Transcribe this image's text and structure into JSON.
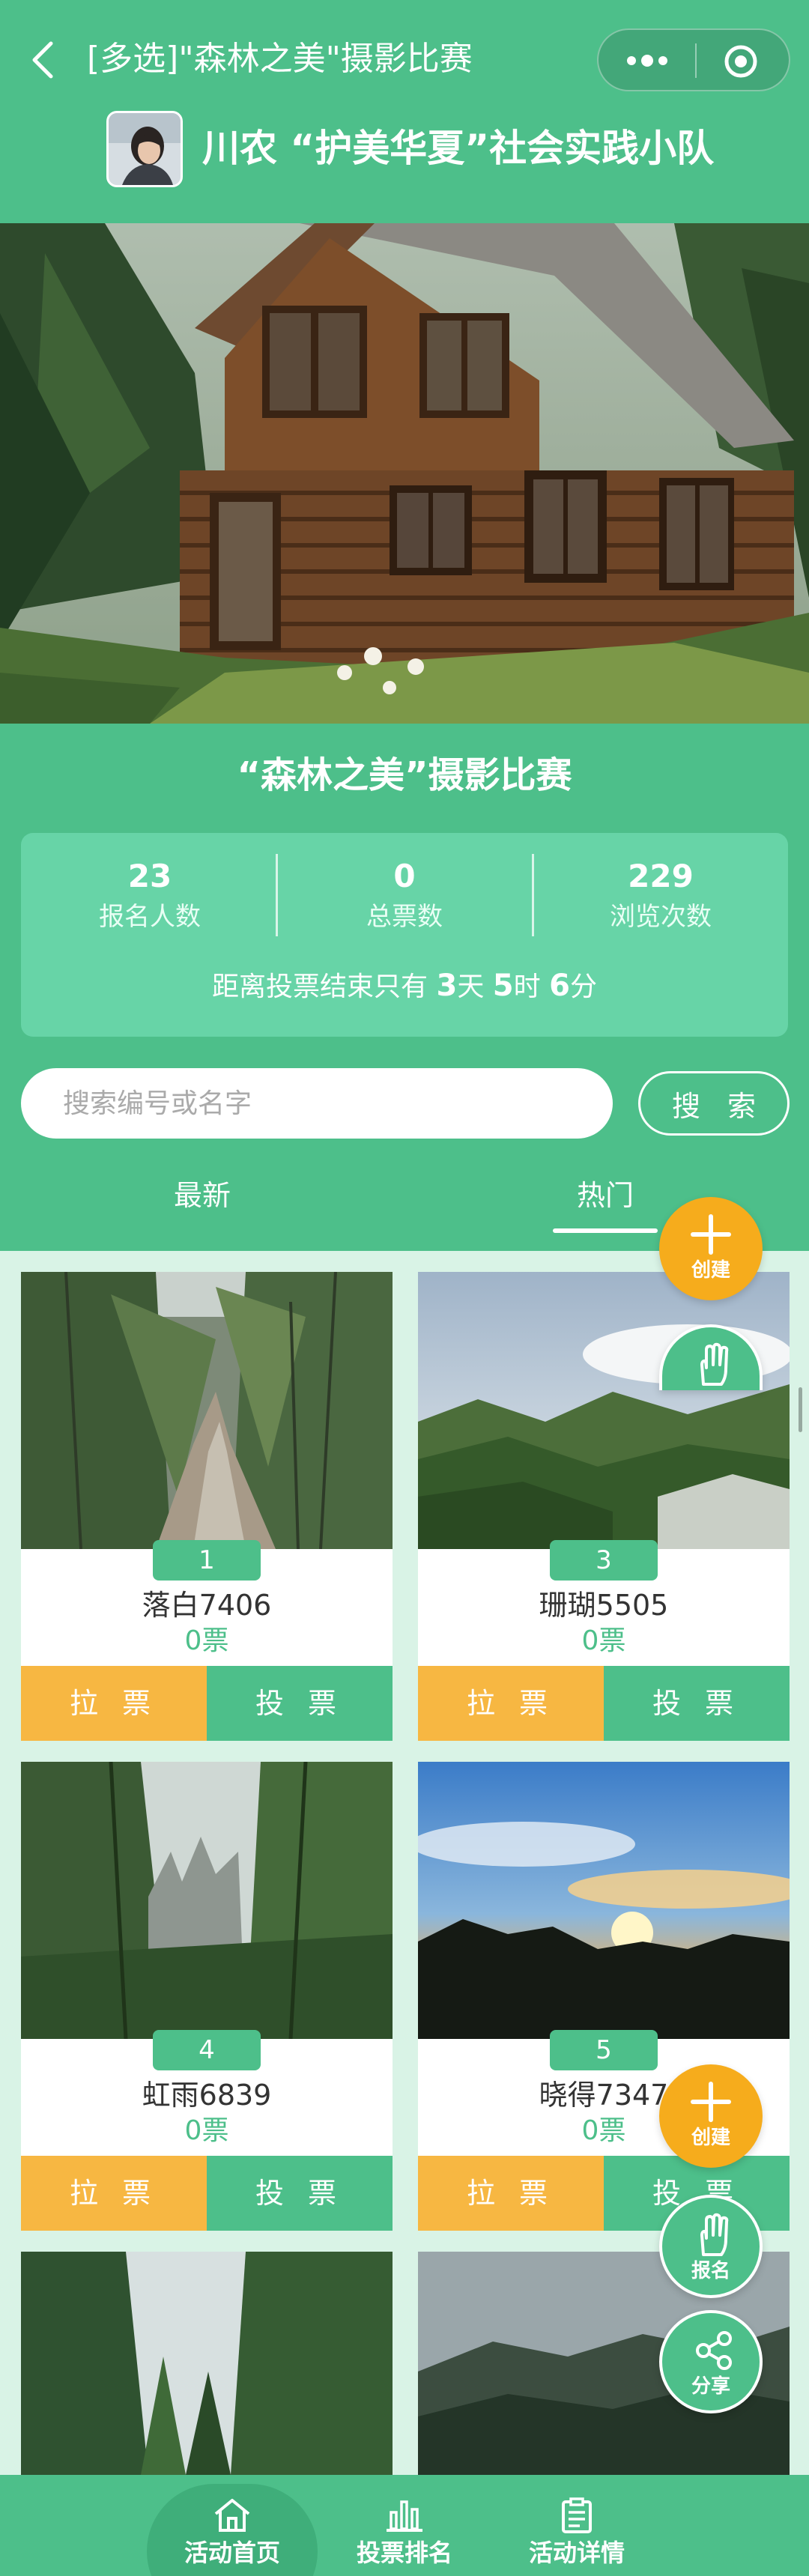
{
  "nav_bar": {
    "title": "[多选]\"森林之美\"摄影比赛"
  },
  "organizer": {
    "name": "川农 “护美华夏”社会实践小队"
  },
  "event": {
    "title": "“森林之美”摄影比赛",
    "stats": [
      {
        "value": "23",
        "label": "报名人数"
      },
      {
        "value": "0",
        "label": "总票数"
      },
      {
        "value": "229",
        "label": "浏览次数"
      }
    ],
    "countdown": {
      "prefix": "距离投票结束只有",
      "days": "3",
      "day_unit": "天",
      "hours": "5",
      "hour_unit": "时",
      "minutes": "6",
      "minute_unit": "分"
    }
  },
  "search": {
    "placeholder": "搜索编号或名字",
    "value": "",
    "button_label": "搜 索"
  },
  "tabs": [
    {
      "label": "最新",
      "active": false
    },
    {
      "label": "热门",
      "active": true
    }
  ],
  "entries": [
    {
      "number": "1",
      "name": "落白7406",
      "votes": "0票",
      "canvass_label": "拉 票",
      "vote_label": "投 票"
    },
    {
      "number": "3",
      "name": "珊瑚5505",
      "votes": "0票",
      "canvass_label": "拉 票",
      "vote_label": "投 票"
    },
    {
      "number": "4",
      "name": "虹雨6839",
      "votes": "0票",
      "canvass_label": "拉 票",
      "vote_label": "投 票"
    },
    {
      "number": "5",
      "name": "晓得7347",
      "votes": "0票",
      "canvass_label": "拉 票",
      "vote_label": "投 票"
    }
  ],
  "floating_buttons": {
    "create_label": "创建",
    "signup_label": "报名",
    "share_label": "分享"
  },
  "bottom_nav": [
    {
      "label": "活动首页",
      "icon": "home-icon",
      "active": true
    },
    {
      "label": "投票排名",
      "icon": "bar-chart-icon",
      "active": false
    },
    {
      "label": "活动详情",
      "icon": "clipboard-icon",
      "active": false
    }
  ],
  "colors": {
    "primary_green": "#4dbf8a",
    "stats_panel": "#67d4a7",
    "orange": "#f7b742",
    "fab_orange": "#f6ac1c",
    "grid_background": "#d9f3e6"
  }
}
